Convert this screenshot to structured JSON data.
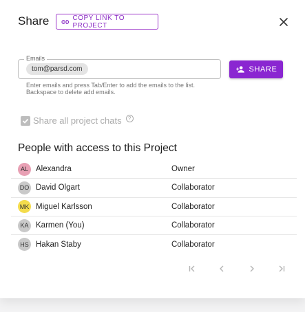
{
  "dialog": {
    "title": "Share",
    "copy_link_label": "COPY LINK TO PROJECT",
    "icons": {
      "copy": "link-icon",
      "close": "close-icon"
    }
  },
  "emails": {
    "label": "Emails",
    "chips": [
      "tom@parsd.com"
    ],
    "helper_text": "Enter emails and press Tab/Enter to add the emails to the list. Backspace to delete add emails."
  },
  "share_button": {
    "label": "SHARE",
    "icon": "person-add-icon",
    "color": "#8a26d1"
  },
  "share_chats": {
    "label": "Share all project chats",
    "checked": true,
    "disabled": true,
    "help_icon": "?"
  },
  "people": {
    "title": "People with access to this Project",
    "rows": [
      {
        "initials": "AL",
        "name": "Alexandra",
        "role": "Owner",
        "avatar_color": "#e8a0b4"
      },
      {
        "initials": "DO",
        "name": "David Olgart",
        "role": "Collaborator",
        "avatar_color": "#c9c9c9"
      },
      {
        "initials": "MK",
        "name": "Miguel Karlsson",
        "role": "Collaborator",
        "avatar_color": "#f4dc4c"
      },
      {
        "initials": "KA",
        "name": "Karmen (You)",
        "role": "Collaborator",
        "avatar_color": "#c9c9c9"
      },
      {
        "initials": "HS",
        "name": "Hakan Staby",
        "role": "Collaborator",
        "avatar_color": "#c9c9c9"
      }
    ]
  },
  "pagination": {
    "first_icon": "first-page-icon",
    "prev_icon": "chevron-left-icon",
    "next_icon": "chevron-right-icon",
    "last_icon": "last-page-icon"
  }
}
